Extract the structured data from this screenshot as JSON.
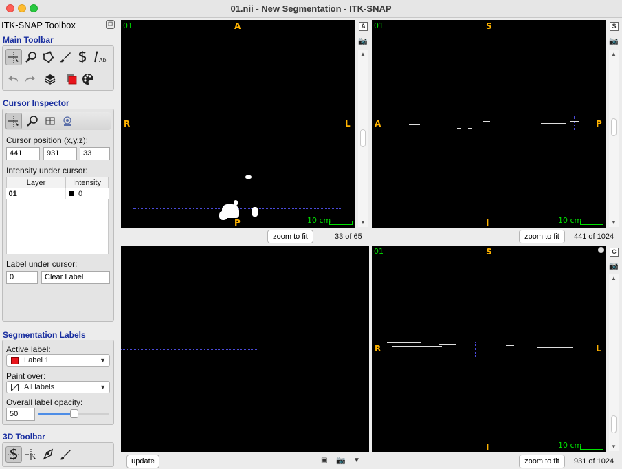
{
  "window": {
    "title": "01.nii - New Segmentation - ITK-SNAP"
  },
  "toolbox": {
    "title": "ITK-SNAP Toolbox",
    "main_toolbar": {
      "heading": "Main Toolbar",
      "tools": [
        "crosshair-tool",
        "zoom-tool",
        "polygon-tool",
        "paintbrush-tool",
        "snake-tool",
        "annotation-tool"
      ],
      "actions": [
        "undo",
        "redo",
        "layers",
        "label-editor",
        "color-map"
      ]
    },
    "cursor_inspector": {
      "heading": "Cursor Inspector",
      "position_label": "Cursor position (x,y,z):",
      "x": "441",
      "y": "931",
      "z": "33",
      "intensity_label": "Intensity under cursor:",
      "columns": [
        "Layer",
        "Intensity"
      ],
      "rows": [
        {
          "layer": "01",
          "intensity": "0"
        }
      ],
      "label_under_cursor_label": "Label under cursor:",
      "label_value": "0",
      "label_name": "Clear Label"
    },
    "segmentation_labels": {
      "heading": "Segmentation Labels",
      "active_label_caption": "Active label:",
      "active_label": "Label 1",
      "active_label_color": "#e8141c",
      "paint_over_caption": "Paint over:",
      "paint_over": "All labels",
      "opacity_caption": "Overall label opacity:",
      "opacity_value": "50",
      "opacity_fraction": 0.5
    },
    "toolbar_3d": {
      "heading": "3D Toolbar"
    }
  },
  "views": {
    "axial": {
      "layer": "01",
      "top": "A",
      "left": "R",
      "right": "L",
      "bottom": "P",
      "scale": "10 cm",
      "zoom_btn": "zoom to fit",
      "slice": "33 of 65",
      "side_btn": "A"
    },
    "sagittal": {
      "layer": "01",
      "top": "S",
      "left": "A",
      "right": "P",
      "bottom": "I",
      "scale": "10 cm",
      "zoom_btn": "zoom to fit",
      "slice": "441 of 1024",
      "side_btn": "S"
    },
    "render3d": {
      "update_btn": "update"
    },
    "coronal": {
      "layer": "01",
      "top": "S",
      "left": "R",
      "right": "L",
      "bottom": "I",
      "scale": "10 cm",
      "zoom_btn": "zoom to fit",
      "slice": "931 of 1024",
      "side_btn": "C"
    }
  },
  "colors": {
    "section_heading": "#1a2fa0",
    "orientation_text": "#ffb300",
    "layer_text": "#00e000",
    "crosshair": "#4a4ad8"
  }
}
